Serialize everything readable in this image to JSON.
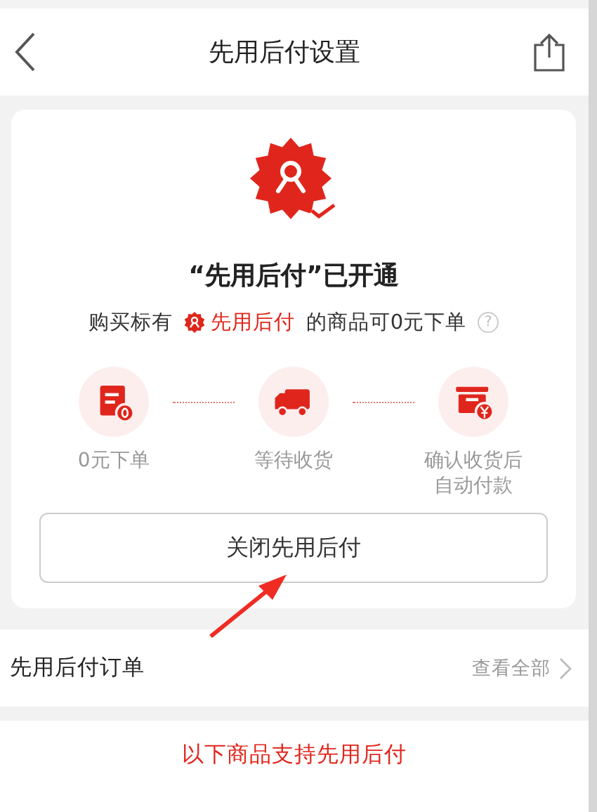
{
  "nav": {
    "title": "先用后付设置"
  },
  "status": {
    "title": "“先用后付”已开通",
    "line_before": "购买标有",
    "line_highlight": "先用后付",
    "line_after": "的商品可0元下单",
    "help_mark": "?"
  },
  "steps": [
    {
      "kind": "order",
      "label": "0元下单"
    },
    {
      "kind": "truck",
      "label": "等待收货"
    },
    {
      "kind": "box",
      "label": "确认收货后自动付款"
    }
  ],
  "close_button": "关闭先用后付",
  "orders_row": {
    "title": "先用后付订单",
    "link": "查看全部"
  },
  "supported_heading": "以下商品支持先用后付"
}
